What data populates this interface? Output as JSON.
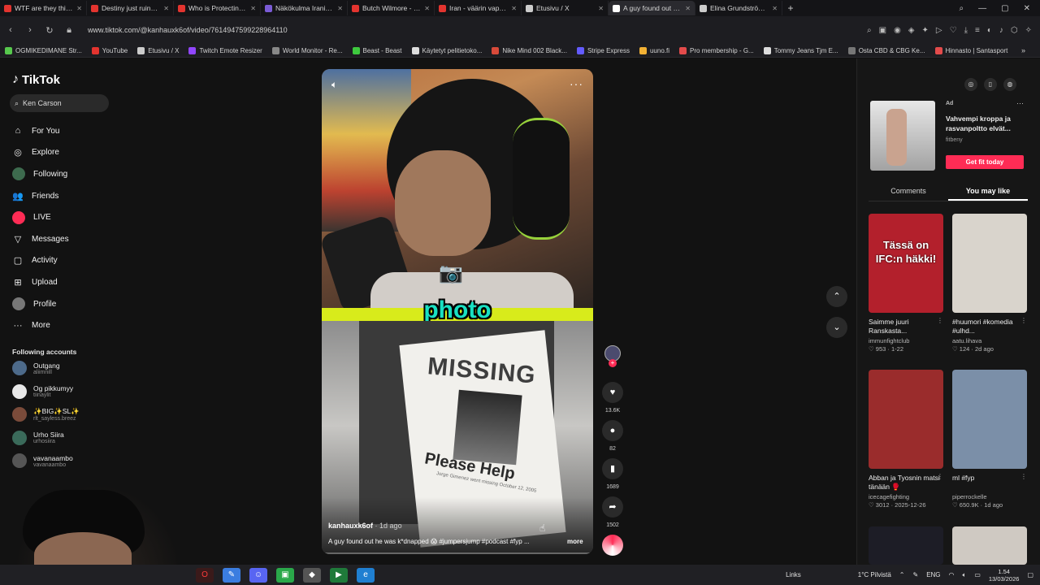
{
  "browser": {
    "tabs": [
      {
        "title": "WTF are they thinking? - Y",
        "color": "#e3342f"
      },
      {
        "title": "Destiny just ruined his car",
        "color": "#e3342f"
      },
      {
        "title": "Who is Protecting the Jeff",
        "color": "#e3342f"
      },
      {
        "title": "Näkökulma Iranin tapaht",
        "color": "#7b5cd6"
      },
      {
        "title": "Butch Wilmore - Elon Mu",
        "color": "#e3342f"
      },
      {
        "title": "Iran - väärin vapautettu?",
        "color": "#e3342f"
      },
      {
        "title": "Etusivu / X",
        "color": "#cccccc"
      },
      {
        "title": "A guy found out he w",
        "color": "#ffffff"
      },
      {
        "title": "Elina Grundström (@Elina",
        "color": "#cccccc"
      }
    ],
    "active_tab_index": 7,
    "url": "www.tiktok.com/@kanhauxk6of/video/7614947599228964110",
    "bookmarks": [
      {
        "label": "OGMIKEDIMANE Str...",
        "color": "#57c84d"
      },
      {
        "label": "YouTube",
        "color": "#e3342f"
      },
      {
        "label": "Etusivu / X",
        "color": "#cccccc"
      },
      {
        "label": "Twitch Emote Resizer",
        "color": "#9146ff"
      },
      {
        "label": "World Monitor - Re...",
        "color": "#888888"
      },
      {
        "label": "Beast - Beast",
        "color": "#3ec93e"
      },
      {
        "label": "Käytetyt pelitietoko...",
        "color": "#dddddd"
      },
      {
        "label": "Nike Mind 002 Black...",
        "color": "#d84a3a"
      },
      {
        "label": "Stripe Express",
        "color": "#635bff"
      },
      {
        "label": "uuno.fi",
        "color": "#f2b134"
      },
      {
        "label": "Pro membership - G...",
        "color": "#e34b4b"
      },
      {
        "label": "Tommy Jeans Tjm E...",
        "color": "#dddddd"
      },
      {
        "label": "Osta CBD & CBG Ke...",
        "color": "#777777"
      },
      {
        "label": "Hinnasto | Santasport",
        "color": "#e34b4b"
      }
    ]
  },
  "sidebar": {
    "brand": "TikTok",
    "search_value": "Ken Carson",
    "nav": [
      {
        "label": "For You",
        "icon": "home-icon",
        "glyph": "⌂"
      },
      {
        "label": "Explore",
        "icon": "compass-icon",
        "glyph": "◎"
      },
      {
        "label": "Following",
        "icon": "following-avatar-icon",
        "glyph": "●"
      },
      {
        "label": "Friends",
        "icon": "friends-icon",
        "glyph": "👥"
      },
      {
        "label": "LIVE",
        "icon": "live-icon",
        "glyph": "●"
      },
      {
        "label": "Messages",
        "icon": "messages-icon",
        "glyph": "▽"
      },
      {
        "label": "Activity",
        "icon": "activity-icon",
        "glyph": "▢"
      },
      {
        "label": "Upload",
        "icon": "upload-icon",
        "glyph": "⊞"
      },
      {
        "label": "Profile",
        "icon": "profile-icon",
        "glyph": "●"
      },
      {
        "label": "More",
        "icon": "more-icon",
        "glyph": "···"
      }
    ],
    "following_title": "Following accounts",
    "following": [
      {
        "name": "Outgang",
        "handle": "aliimnill"
      },
      {
        "name": "Og pikkumyy",
        "handle": "tiinaylit"
      },
      {
        "name": "✨BIG✨SL✨",
        "handle": "rlt_sayless.breez"
      },
      {
        "name": "Urho Siira",
        "handle": "urhosiira"
      },
      {
        "name": "vavanaambo",
        "handle": "vavanaambo"
      }
    ]
  },
  "video": {
    "caption_word": "photo",
    "flyer_heading": "MISSING",
    "flyer_sub": "Please Help",
    "flyer_fine": "Jorge Gimenez went missing October 12, 2005",
    "author": "kanhauxk6of",
    "age": "· 1d ago",
    "description": "A guy found out he was k*dnapped 😱 #jumpersjump #podcast #fyp ...",
    "more_label": "more",
    "likes": "13.6K",
    "comments": "82",
    "saves": "1689",
    "shares": "1502"
  },
  "right_panel": {
    "ad": {
      "label": "Ad",
      "title": "Vahvempi kroppa ja rasvanpoltto elvät...",
      "brand": "fitbeny",
      "cta": "Get fit today"
    },
    "tabs": [
      "Comments",
      "You may like"
    ],
    "active_tab": 1,
    "cards": [
      {
        "overlay": "Tässä on IFC:n häkki!",
        "title": "Saimme juuri Ranskasta...",
        "user": "immunfightclub",
        "stats": "♡ 953 · 1-22",
        "bg": "#b3202c"
      },
      {
        "overlay": "",
        "title": "#huumori #komedia #ulhd...",
        "user": "aatu.lihava",
        "stats": "♡ 124 · 2d ago",
        "bg": "#d9d4cc"
      },
      {
        "overlay": "",
        "title": "Abban ja Tyosnin matsi tänään 🥊",
        "user": "icecagefighting",
        "stats": "♡ 3012 · 2025-12-26",
        "bg": "#9a2c2c"
      },
      {
        "overlay": "",
        "title": "ml #fyp",
        "user": "piperrockelle",
        "stats": "♡ 650.9K · 1d ago",
        "bg": "#7b8fa8"
      }
    ]
  },
  "taskbar": {
    "links_label": "Links",
    "weather": "1°C  Pilvistä",
    "lang": "ENG",
    "time": "1.54",
    "date": "13/03/2026"
  }
}
